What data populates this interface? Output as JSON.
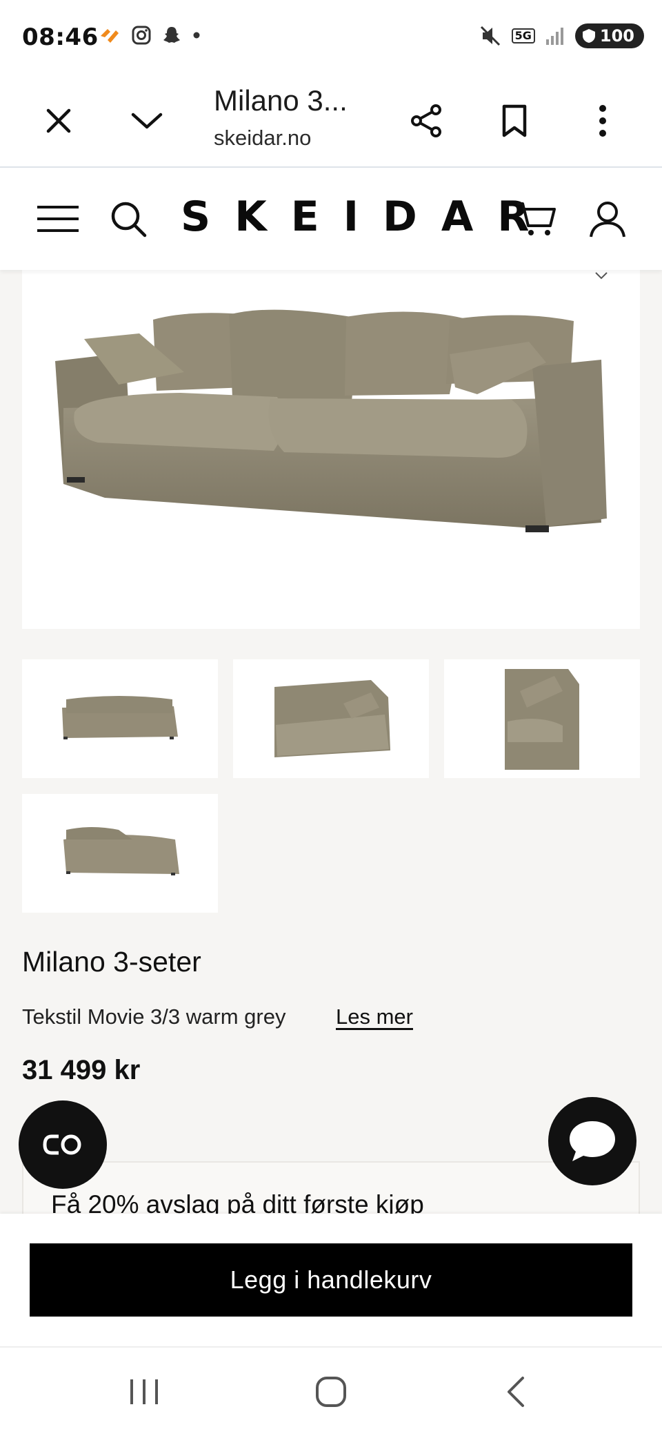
{
  "status_bar": {
    "time": "08:46",
    "battery": "100",
    "network": "5G"
  },
  "browser": {
    "title": "Milano 3...",
    "url": "skeidar.no",
    "icons": [
      "close-icon",
      "chevron-down-icon",
      "share-icon",
      "bookmark-icon",
      "more-vertical-icon"
    ]
  },
  "site_header": {
    "logo": "SKEIDAR",
    "icons": [
      "menu-icon",
      "search-icon",
      "cart-icon",
      "user-icon"
    ]
  },
  "gallery": {
    "thumbnails": [
      "sofa-front-view",
      "sofa-angle-view",
      "sofa-side-view",
      "sofa-back-view"
    ]
  },
  "product": {
    "name": "Milano 3-seter",
    "variant": "Tekstil Movie 3/3 warm grey",
    "read_more": "Les mer",
    "price": "31 499 kr"
  },
  "promo": {
    "text": "Få 20% avslag på ditt første kjøp"
  },
  "cart": {
    "button_label": "Legg i handlekurv"
  },
  "colors": {
    "sofa": "#8b8470",
    "background": "#f6f5f3",
    "button": "#000000"
  }
}
